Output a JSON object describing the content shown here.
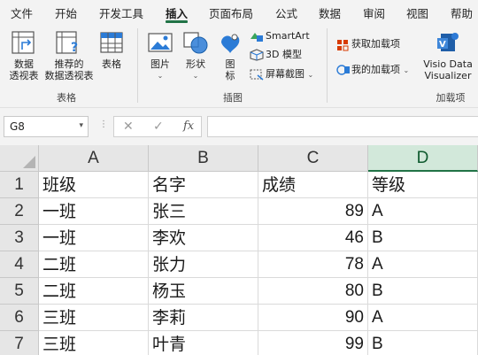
{
  "tabs": [
    "文件",
    "开始",
    "开发工具",
    "插入",
    "页面布局",
    "公式",
    "数据",
    "审阅",
    "视图",
    "帮助"
  ],
  "active_tab": "插入",
  "ribbon": {
    "tables": {
      "pivot_line1": "数据",
      "pivot_line2": "透视表",
      "rec_pivot_line1": "推荐的",
      "rec_pivot_line2": "数据透视表",
      "table": "表格",
      "group": "表格"
    },
    "illustrations": {
      "pictures": "图片",
      "shapes": "形状",
      "icons_line1": "图",
      "icons_line2": "标",
      "smartart": "SmartArt",
      "model3d": "3D 模型",
      "screenshot": "屏幕截图",
      "group": "插图"
    },
    "addins": {
      "get_addins": "获取加载项",
      "my_addins": "我的加载项",
      "visio_line1": "Visio Data",
      "visio_line2": "Visualizer",
      "group": "加载项"
    }
  },
  "formula_bar": {
    "name_box": "G8",
    "cancel": "✕",
    "enter": "✓",
    "fx": "fx",
    "formula": ""
  },
  "sheet": {
    "columns": [
      "A",
      "B",
      "C",
      "D"
    ],
    "selected_column": "D",
    "rows": [
      "1",
      "2",
      "3",
      "4",
      "5",
      "6",
      "7"
    ],
    "cells": [
      [
        "班级",
        "名字",
        "成绩",
        "等级"
      ],
      [
        "一班",
        "张三",
        "89",
        "A"
      ],
      [
        "一班",
        "李欢",
        "46",
        "B"
      ],
      [
        "二班",
        "张力",
        "78",
        "A"
      ],
      [
        "二班",
        "杨玉",
        "80",
        "B"
      ],
      [
        "三班",
        "李莉",
        "90",
        "A"
      ],
      [
        "三班",
        "叶青",
        "99",
        "B"
      ]
    ]
  },
  "colors": {
    "accent": "#217346",
    "ribbon_bg": "#f3f3f3",
    "selected_header": "#d2e8da"
  }
}
